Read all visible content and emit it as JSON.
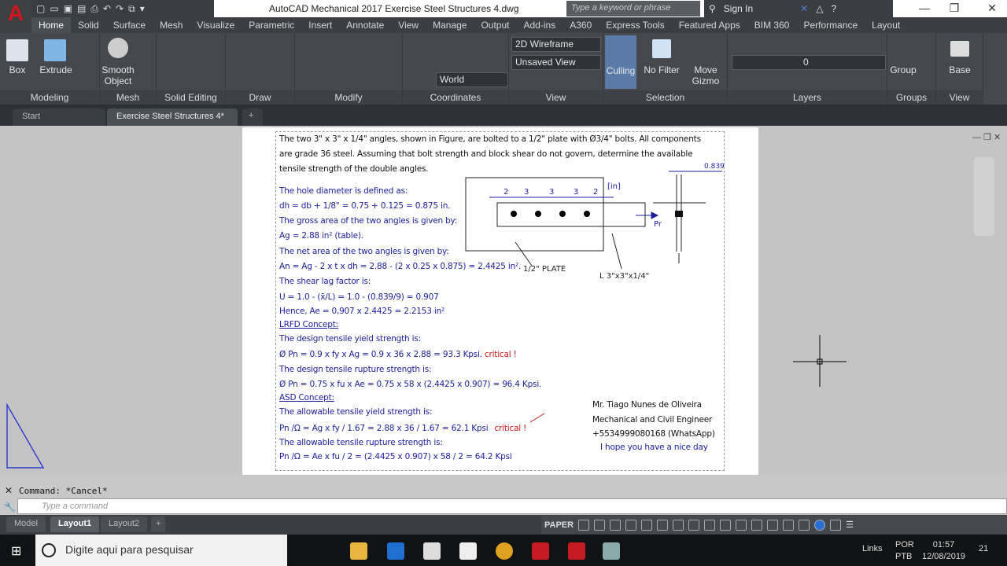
{
  "app": {
    "title": "AutoCAD Mechanical 2017    Exercise Steel Structures 4.dwg",
    "logo": "A",
    "search_placeholder": "Type a keyword or phrase",
    "sign_in": "Sign In"
  },
  "ribbon_tabs": [
    "Home",
    "Solid",
    "Surface",
    "Mesh",
    "Visualize",
    "Parametric",
    "Insert",
    "Annotate",
    "View",
    "Manage",
    "Output",
    "Add-ins",
    "A360",
    "Express Tools",
    "Featured Apps",
    "BIM 360",
    "Performance",
    "Layout"
  ],
  "active_tab": "Home",
  "panels": {
    "modeling": "Modeling",
    "mesh": "Mesh",
    "solid_editing": "Solid Editing",
    "draw": "Draw",
    "modify": "Modify",
    "coordinates": "Coordinates",
    "view": "View",
    "selection": "Selection",
    "layers": "Layers",
    "groups": "Groups",
    "view2": "View"
  },
  "buttons": {
    "box": "Box",
    "extrude": "Extrude",
    "smooth": "Smooth",
    "object": "Object",
    "culling": "Culling",
    "no_filter": "No Filter",
    "move": "Move",
    "gizmo": "Gizmo",
    "group": "Group",
    "base": "Base"
  },
  "dropdowns": {
    "visual_style": "2D Wireframe",
    "view": "Unsaved View",
    "ucs": "World",
    "layer": "0"
  },
  "file_tabs": {
    "start": "Start",
    "doc": "Exercise Steel Structures 4*",
    "new": "+"
  },
  "drawing": {
    "problem": [
      "The two 3\" x 3\" x 1/4\" angles, shown in Figure, are bolted to a 1/2\" plate with Ø3/4\" bolts. All components",
      "are  grade 36 steel.  Assuming that bolt strength and  block shear do not govern,  determine the available",
      "tensile strength of the double angles."
    ],
    "solution": [
      "The hole diameter is defined as:",
      "dh = db + 1/8\" = 0.75 + 0.125 = 0.875 in.",
      "The gross area of the two angles is given by:",
      "Ag = 2.88 in² (table).",
      "The net area of the two angles is given by:",
      "An = Ag - 2 x t x dh = 2.88 - (2 x 0.25 x 0.875) = 2.4425 in².",
      "The shear lag factor is:",
      "U = 1.0 - (x̄/L) = 1.0 - (0.839/9) = 0.907",
      "Hence, Ae = 0,907 x 2.4425 = 2.2153 in²",
      "LRFD Concept:",
      "The design tensile yield strength is:",
      "Ø Pn = 0.9 x fy x Ag = 0.9 x 36 x 2.88 = 93.3 Kpsi.",
      "The design tensile rupture strength is:",
      "Ø Pn = 0.75 x fu x Ae = 0.75 x 58 x (2.4425 x 0.907) = 96.4 Kpsi.",
      "ASD Concept:",
      "The allowable tensile yield strength is:",
      "Pn /Ω = Ag x fy / 1.67 = 2.88 x 36 / 1.67 = 62.1 Kpsi",
      "The allowable tensile rupture strength is:",
      "Pn /Ω = Ae x fu / 2 = (2.4425 x 0.907) x 58 / 2 = 64.2 Kpsi"
    ],
    "critical": "critical !",
    "figure": {
      "dims": [
        "2",
        "3",
        "3",
        "3",
        "2"
      ],
      "unit": "[in]",
      "load": "Pr",
      "plate": "1/2\" PLATE",
      "angle": "L 3\"x3\"x1/4\"",
      "xbar": "0.839"
    },
    "author": [
      "Mr. Tiago Nunes de Oliveira",
      "Mechanical and Civil Engineer",
      "+5534999080168 (WhatsApp)",
      "I hope you have a nice day"
    ]
  },
  "command": {
    "history": "Command: *Cancel*",
    "placeholder": "Type a command"
  },
  "layout_tabs": [
    "Model",
    "Layout1",
    "Layout2",
    "+"
  ],
  "status": {
    "space": "PAPER"
  },
  "taskbar": {
    "search": "Digite aqui para pesquisar",
    "links": "Links",
    "lang1": "POR",
    "lang2": "PTB",
    "time": "01:57",
    "date": "12/08/2019",
    "notif": "21"
  },
  "colors": {
    "blue_text": "#1d1d9c",
    "red_text": "#c21818",
    "ribbon": "#45484d"
  }
}
